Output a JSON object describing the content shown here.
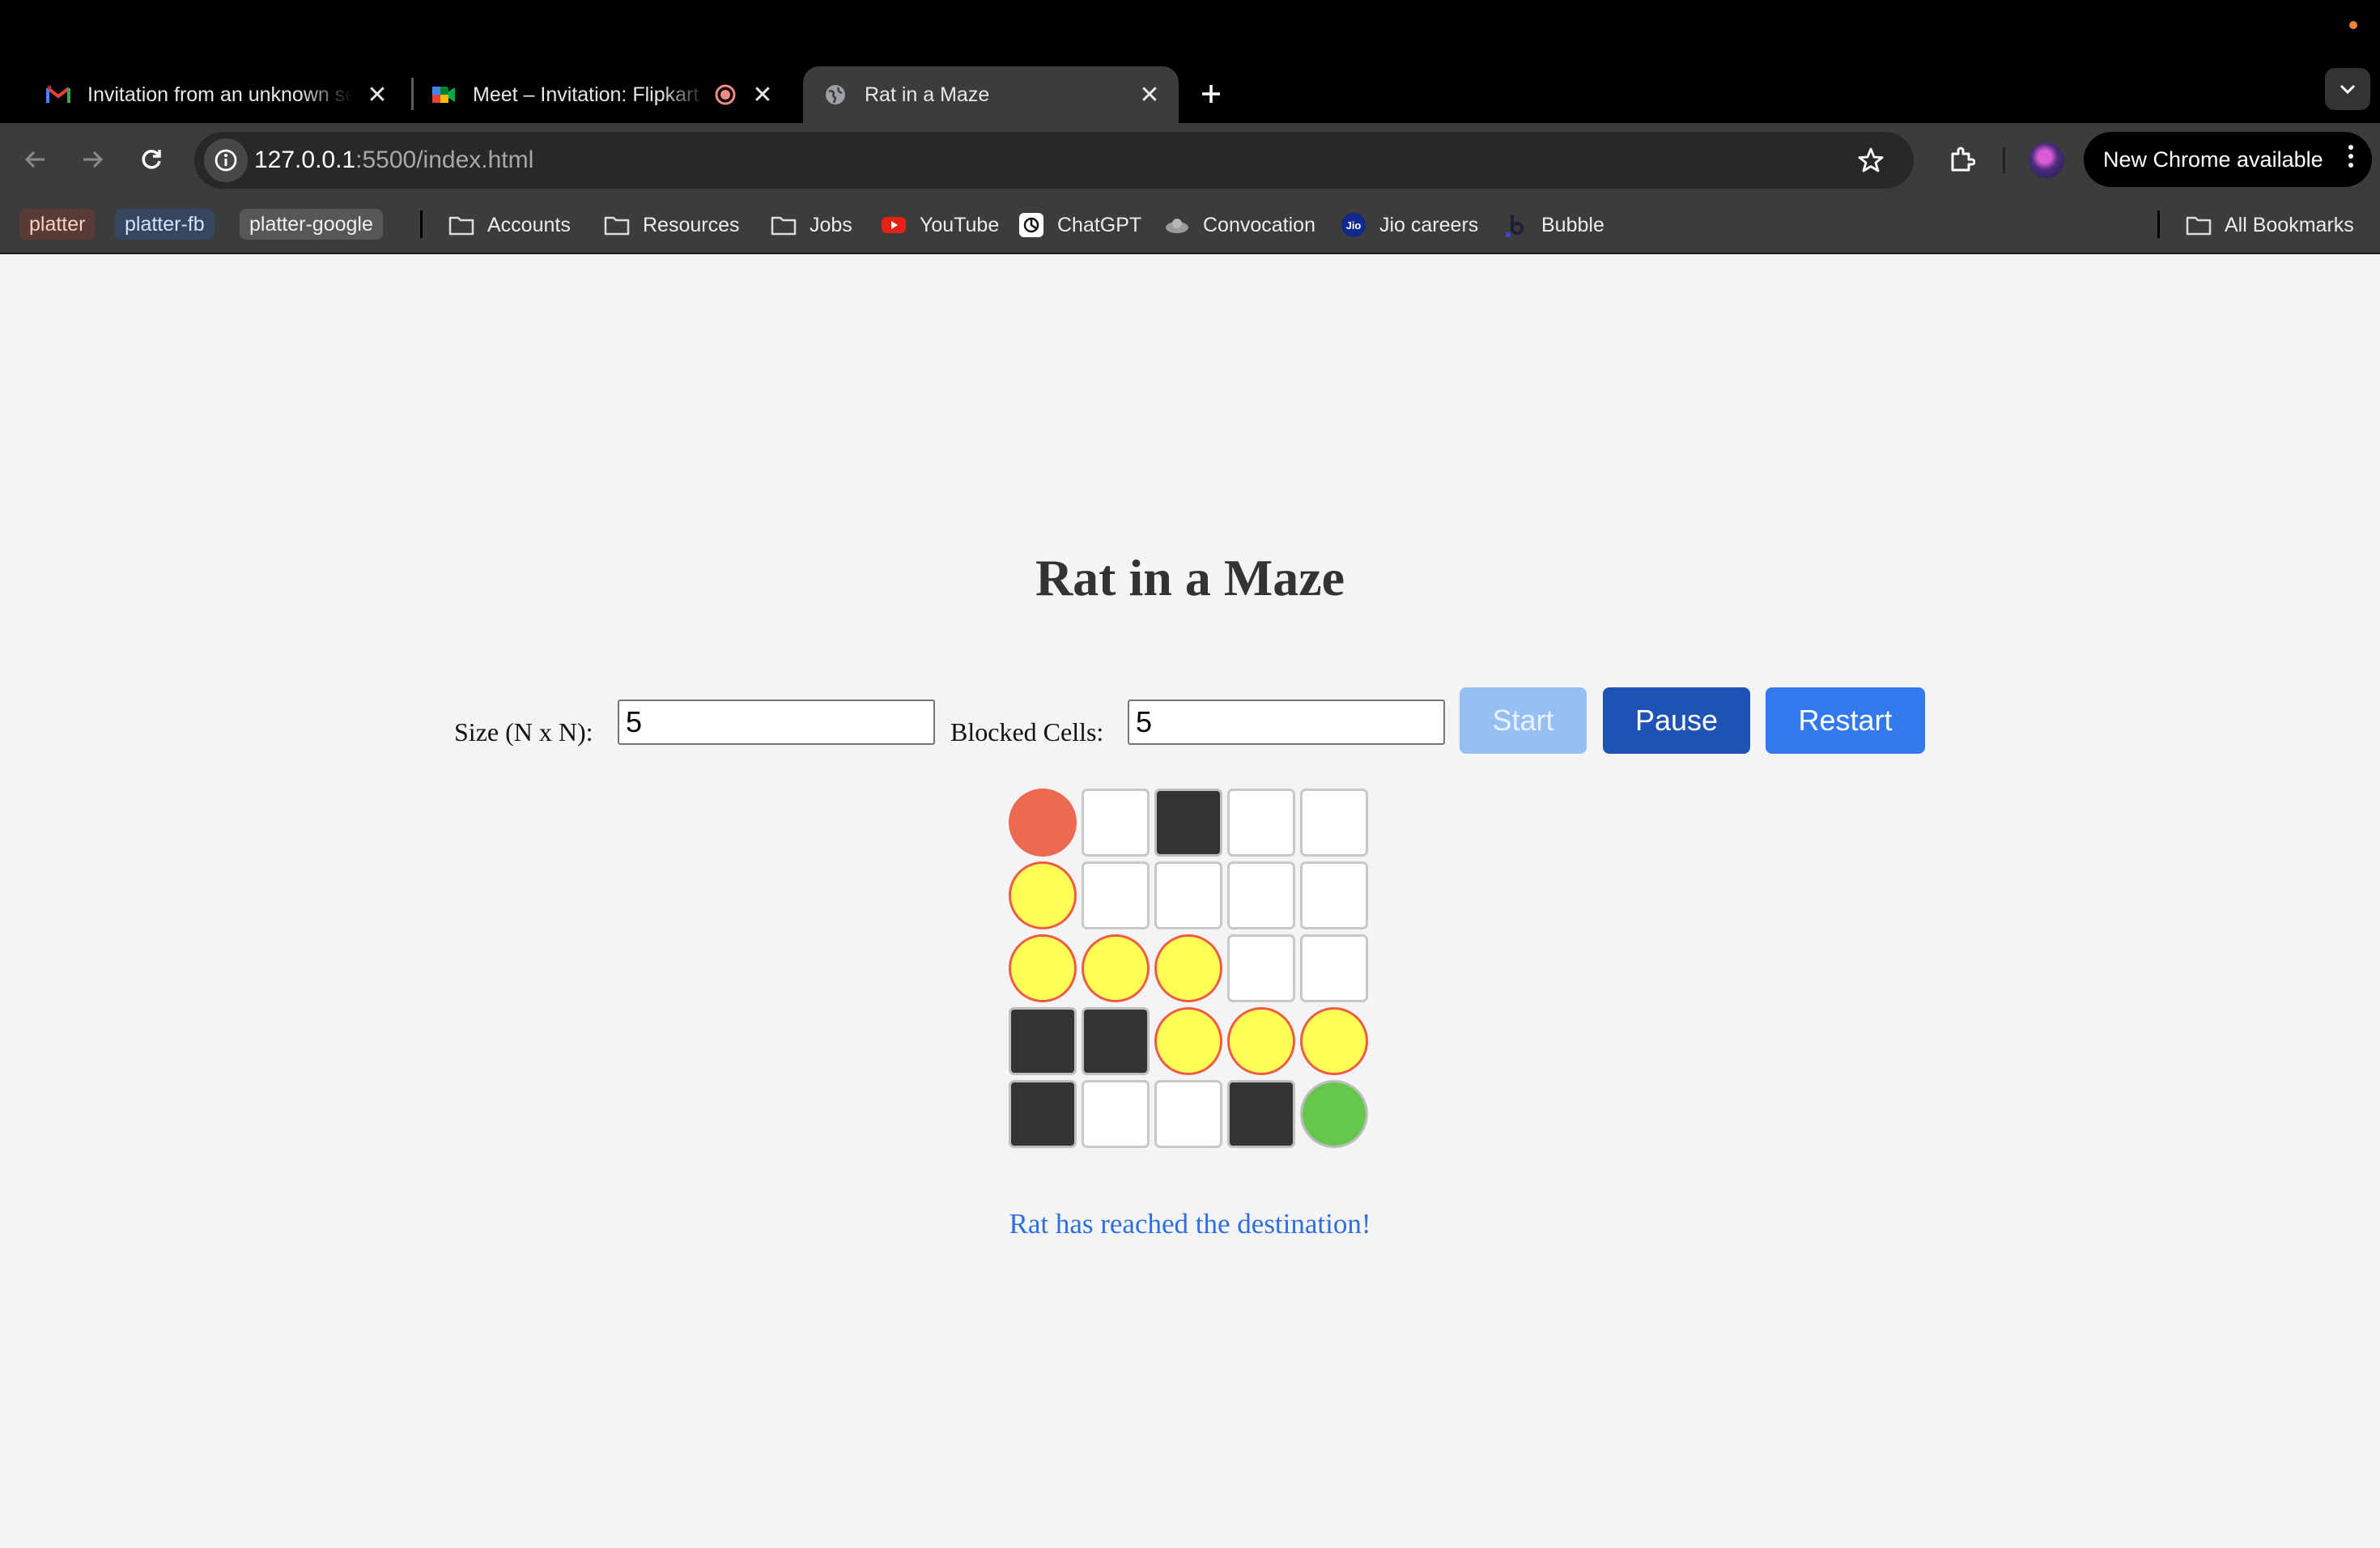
{
  "browser": {
    "tabs": [
      {
        "title": "Invitation from an unknown se",
        "favicon": "gmail-icon",
        "active": false
      },
      {
        "title": "Meet – Invitation: Flipkart",
        "favicon": "meet-icon",
        "active": false
      },
      {
        "title": "Rat in a Maze",
        "favicon": "globe-icon",
        "active": true
      }
    ],
    "url_host": "127.0.0.1",
    "url_path": ":5500/index.html",
    "update_label": "New Chrome available",
    "bookmarks": {
      "chips": [
        "platter",
        "platter-fb",
        "platter-google"
      ],
      "items": [
        {
          "label": "Accounts",
          "icon": "folder-icon"
        },
        {
          "label": "Resources",
          "icon": "folder-icon"
        },
        {
          "label": "Jobs",
          "icon": "folder-icon"
        },
        {
          "label": "YouTube",
          "icon": "youtube-icon"
        },
        {
          "label": "ChatGPT",
          "icon": "chatgpt-icon"
        },
        {
          "label": "Convocation",
          "icon": "cloud-icon"
        },
        {
          "label": "Jio careers",
          "icon": "jio-icon"
        },
        {
          "label": "Bubble",
          "icon": "bubble-icon"
        }
      ],
      "all_bookmarks": "All Bookmarks"
    }
  },
  "app": {
    "title": "Rat in a Maze",
    "size_label": "Size (N x N):",
    "size_value": "5",
    "blocked_label": "Blocked Cells:",
    "blocked_value": "5",
    "buttons": {
      "start": "Start",
      "pause": "Pause",
      "restart": "Restart"
    },
    "start_disabled": true,
    "status": "Rat has reached the destination!"
  },
  "maze": {
    "size": 5,
    "cells": [
      [
        "rat",
        "open",
        "wall",
        "open",
        "open"
      ],
      [
        "path",
        "open",
        "open",
        "open",
        "open"
      ],
      [
        "path",
        "path",
        "path",
        "open",
        "open"
      ],
      [
        "wall",
        "wall",
        "path",
        "path",
        "path"
      ],
      [
        "wall",
        "open",
        "open",
        "wall",
        "goal"
      ]
    ]
  },
  "colors": {
    "wall": "#333333",
    "path_fill": "#ffff55",
    "path_border": "#ef5c46",
    "rat": "#ec6b50",
    "goal": "#65c84d",
    "status_text": "#2f6ee0"
  }
}
